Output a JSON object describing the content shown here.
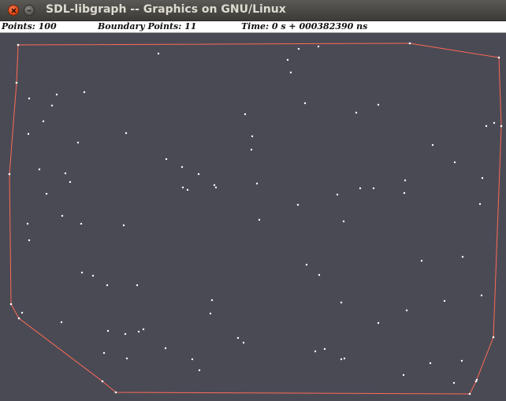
{
  "window": {
    "title": "SDL-libgraph -- Graphics on GNU/Linux"
  },
  "status": {
    "points": "Points: 100",
    "boundary": "Boundary Points: 11",
    "time": "Time: 0 s + 000382390 ns"
  },
  "colors": {
    "canvas": "#4a4a55",
    "hull": "#ff6a55",
    "point": "#ffffff"
  },
  "chart_data": {
    "type": "scatter",
    "xlim": [
      0,
      640
    ],
    "ylim": [
      42,
      509
    ],
    "hull": [
      [
        23,
        57
      ],
      [
        520,
        55
      ],
      [
        633,
        73
      ],
      [
        636,
        160
      ],
      [
        626,
        428
      ],
      [
        604,
        484
      ],
      [
        596,
        500
      ],
      [
        147,
        498
      ],
      [
        130,
        484
      ],
      [
        24,
        404
      ],
      [
        14,
        386
      ],
      [
        12,
        221
      ],
      [
        21,
        105
      ],
      [
        23,
        57
      ]
    ],
    "points": [
      [
        201,
        68
      ],
      [
        365,
        76
      ],
      [
        379,
        62
      ],
      [
        404,
        59
      ],
      [
        369,
        92
      ],
      [
        37,
        125
      ],
      [
        72,
        120
      ],
      [
        107,
        117
      ],
      [
        66,
        134
      ],
      [
        387,
        131
      ],
      [
        480,
        133
      ],
      [
        55,
        154
      ],
      [
        311,
        145
      ],
      [
        452,
        143
      ],
      [
        617,
        160
      ],
      [
        627,
        156
      ],
      [
        36,
        170
      ],
      [
        160,
        169
      ],
      [
        320,
        173
      ],
      [
        99,
        181
      ],
      [
        319,
        190
      ],
      [
        549,
        184
      ],
      [
        211,
        202
      ],
      [
        577,
        206
      ],
      [
        50,
        215
      ],
      [
        231,
        212
      ],
      [
        83,
        220
      ],
      [
        252,
        221
      ],
      [
        89,
        231
      ],
      [
        232,
        238
      ],
      [
        238,
        241
      ],
      [
        272,
        235
      ],
      [
        274,
        238
      ],
      [
        326,
        233
      ],
      [
        514,
        229
      ],
      [
        612,
        226
      ],
      [
        59,
        246
      ],
      [
        457,
        239
      ],
      [
        474,
        239
      ],
      [
        428,
        247
      ],
      [
        513,
        245
      ],
      [
        378,
        260
      ],
      [
        609,
        259
      ],
      [
        79,
        274
      ],
      [
        35,
        284
      ],
      [
        103,
        284
      ],
      [
        157,
        286
      ],
      [
        329,
        279
      ],
      [
        436,
        281
      ],
      [
        37,
        305
      ],
      [
        587,
        326
      ],
      [
        535,
        331
      ],
      [
        389,
        336
      ],
      [
        104,
        346
      ],
      [
        118,
        350
      ],
      [
        405,
        349
      ],
      [
        136,
        362
      ],
      [
        174,
        362
      ],
      [
        269,
        381
      ],
      [
        564,
        382
      ],
      [
        611,
        375
      ],
      [
        28,
        397
      ],
      [
        433,
        384
      ],
      [
        267,
        398
      ],
      [
        516,
        394
      ],
      [
        78,
        409
      ],
      [
        480,
        410
      ],
      [
        137,
        420
      ],
      [
        159,
        424
      ],
      [
        182,
        418
      ],
      [
        176,
        421
      ],
      [
        302,
        429
      ],
      [
        309,
        435
      ],
      [
        210,
        442
      ],
      [
        400,
        446
      ],
      [
        412,
        443
      ],
      [
        132,
        448
      ],
      [
        161,
        455
      ],
      [
        244,
        456
      ],
      [
        433,
        456
      ],
      [
        437,
        455
      ],
      [
        586,
        458
      ],
      [
        546,
        461
      ],
      [
        253,
        470
      ],
      [
        512,
        476
      ],
      [
        576,
        486
      ],
      [
        605,
        482
      ]
    ]
  }
}
